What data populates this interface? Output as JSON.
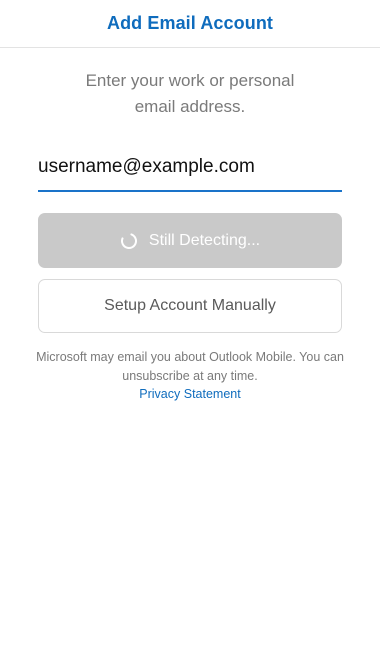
{
  "header": {
    "title": "Add Email Account"
  },
  "main": {
    "instructions": "Enter your work or personal email address.",
    "email_value": "username@example.com",
    "detect_button_label": "Still Detecting...",
    "manual_button_label": "Setup Account Manually",
    "disclaimer": "Microsoft may email you about Outlook Mobile. You can unsubscribe at any time.",
    "privacy_link_label": "Privacy Statement"
  },
  "icons": {
    "spinner": "loading-spinner-icon"
  },
  "colors": {
    "accent": "#0f6cbd",
    "input_underline": "#1a73c9",
    "disabled_button": "#c9c9c9",
    "muted_text": "#7a7a7a"
  }
}
